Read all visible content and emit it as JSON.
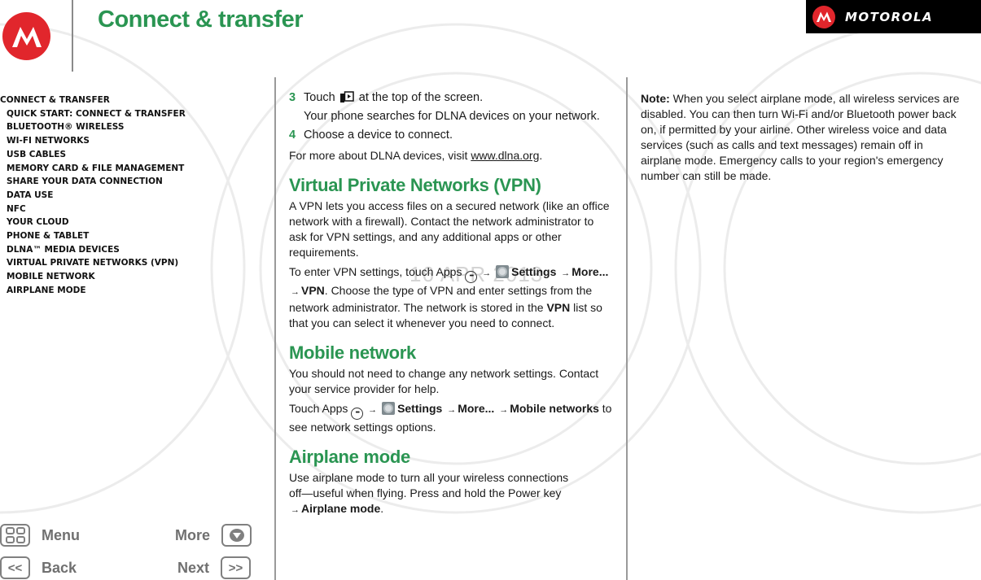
{
  "header": {
    "title": "Connect & transfer",
    "brand": "MOTOROLA",
    "brand_color": "#e1262c",
    "title_color": "#2a9552"
  },
  "watermark": {
    "date": "16 APR 2013"
  },
  "toc": {
    "items": [
      {
        "label": "Connect & transfer",
        "level": 0
      },
      {
        "label": "Quick Start: Connect & transfer",
        "level": 1
      },
      {
        "label": "Bluetooth® wireless",
        "level": 1
      },
      {
        "label": "Wi-Fi Networks",
        "level": 1
      },
      {
        "label": "USB cables",
        "level": 1
      },
      {
        "label": "Memory card & file management",
        "level": 1
      },
      {
        "label": "Share your data connection",
        "level": 1
      },
      {
        "label": "Data use",
        "level": 1
      },
      {
        "label": "NFC",
        "level": 1
      },
      {
        "label": "Your cloud",
        "level": 1
      },
      {
        "label": "Phone & tablet",
        "level": 1
      },
      {
        "label": "DLNA™ Media devices",
        "level": 1
      },
      {
        "label": "Virtual Private Networks (VPN)",
        "level": 1
      },
      {
        "label": "Mobile network",
        "level": 1
      },
      {
        "label": "Airplane mode",
        "level": 1
      }
    ]
  },
  "nav": {
    "menu": "Menu",
    "more": "More",
    "back": "Back",
    "next": "Next",
    "back_glyph": "<<",
    "next_glyph": ">>"
  },
  "main": {
    "step3_num": "3",
    "step3_a": "Touch",
    "step3_b": "at the top of the screen.",
    "step3_sub": "Your phone searches for DLNA devices on your network.",
    "step4_num": "4",
    "step4": "Choose a device to connect.",
    "dlna_more_a": "For more about DLNA devices, visit ",
    "dlna_link": "www.dlna.org",
    "dlna_more_b": ".",
    "vpn": {
      "heading": "Virtual Private Networks (VPN)",
      "p1": "A VPN lets you access files on a secured network (like an office network with a firewall). Contact the network administrator to ask for VPN settings, and any additional apps or other requirements.",
      "p2_a": "To enter VPN settings, touch Apps",
      "p2_settings": "Settings",
      "p2_more": "More...",
      "p2_vpn": "VPN",
      "p2_b": ". Choose the type of VPN and enter settings from the network administrator. The network is stored in the ",
      "p2_vpn2": "VPN",
      "p2_c": " list so that you can select it whenever you need to connect."
    },
    "mobile": {
      "heading": "Mobile network",
      "p1": "You should not need to change any network settings. Contact your service provider for help.",
      "p2_a": "Touch Apps",
      "p2_settings": "Settings",
      "p2_more": "More...",
      "p2_networks": "Mobile networks",
      "p2_b": " to see network settings options."
    },
    "airplane": {
      "heading": "Airplane mode",
      "p1_a": "Use airplane mode to turn all your wireless connections off—useful when flying. Press and hold the Power key",
      "p1_b": "Airplane mode",
      "p1_c": "."
    }
  },
  "right": {
    "note_label": "Note:",
    "note_text": " When you select airplane mode, all wireless services are disabled. You can then turn Wi-Fi and/or Bluetooth power back on, if permitted by your airline. Other wireless voice and data services (such as calls and text messages) remain off in airplane mode. Emergency calls to your region's emergency number can still be made."
  },
  "symbols": {
    "arrow": "→",
    "apps_dots": "⋯"
  }
}
